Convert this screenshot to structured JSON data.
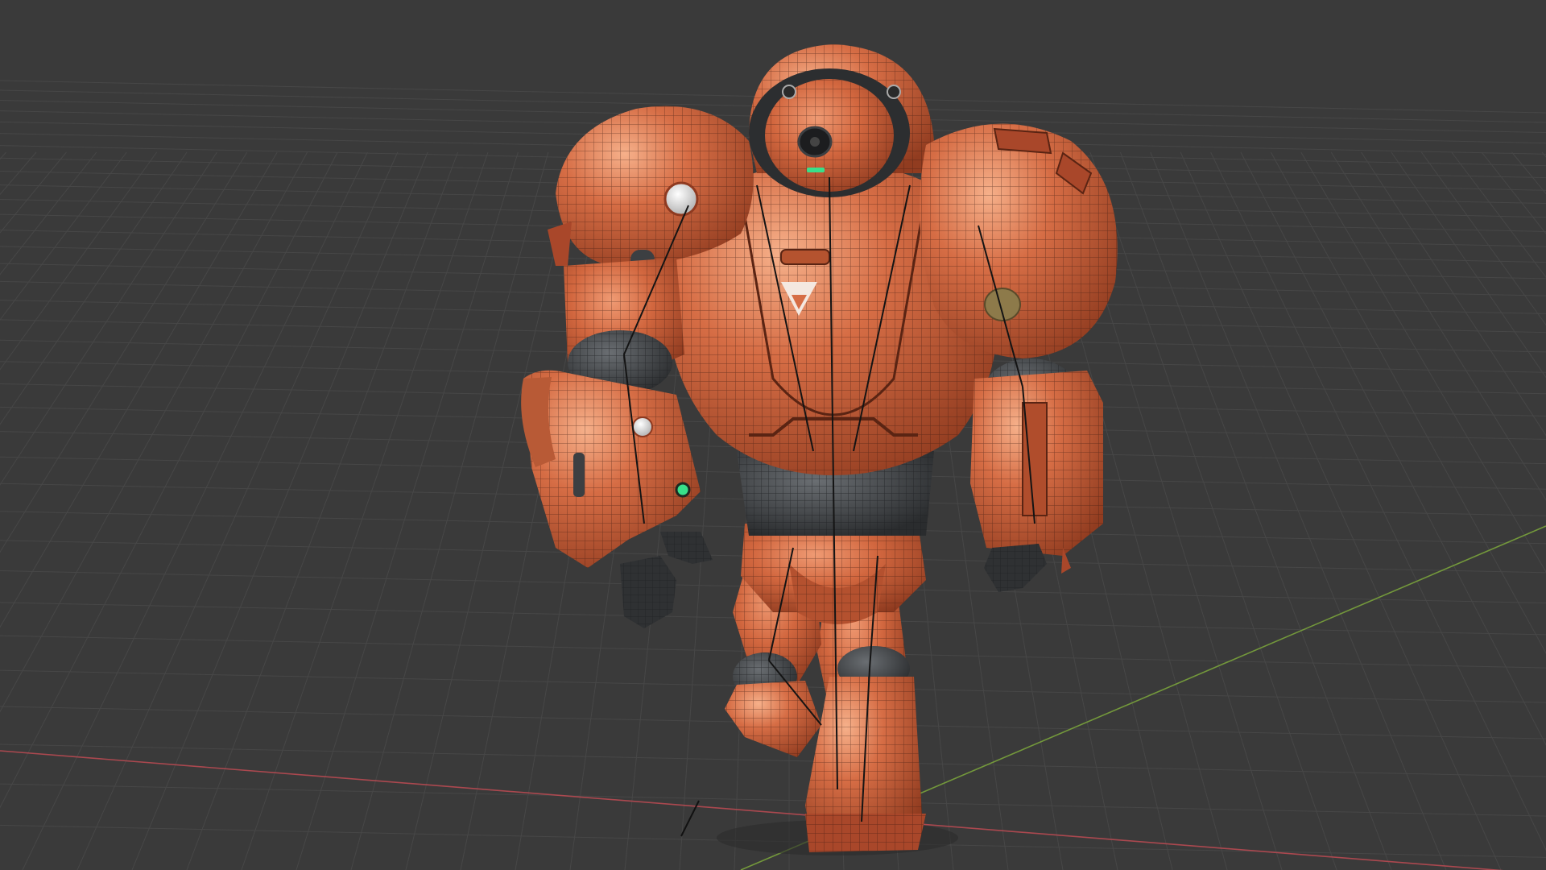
{
  "viewport": {
    "shading": "wireframe-overlay-solid",
    "background_color": "#3a3a3a",
    "grid_color": "#474747",
    "x_axis_color": "#b84a52",
    "y_axis_color": "#7aa33c"
  },
  "model": {
    "subject": "orange-armored-robot",
    "armor_color": "#c95b3a",
    "armor_highlight_color": "#e98a62",
    "wire_color": "#3a1a10",
    "joint_color": "#3c3f42",
    "accent_light_color": "#38e08a",
    "emblem_color": "#f4e8e0"
  }
}
